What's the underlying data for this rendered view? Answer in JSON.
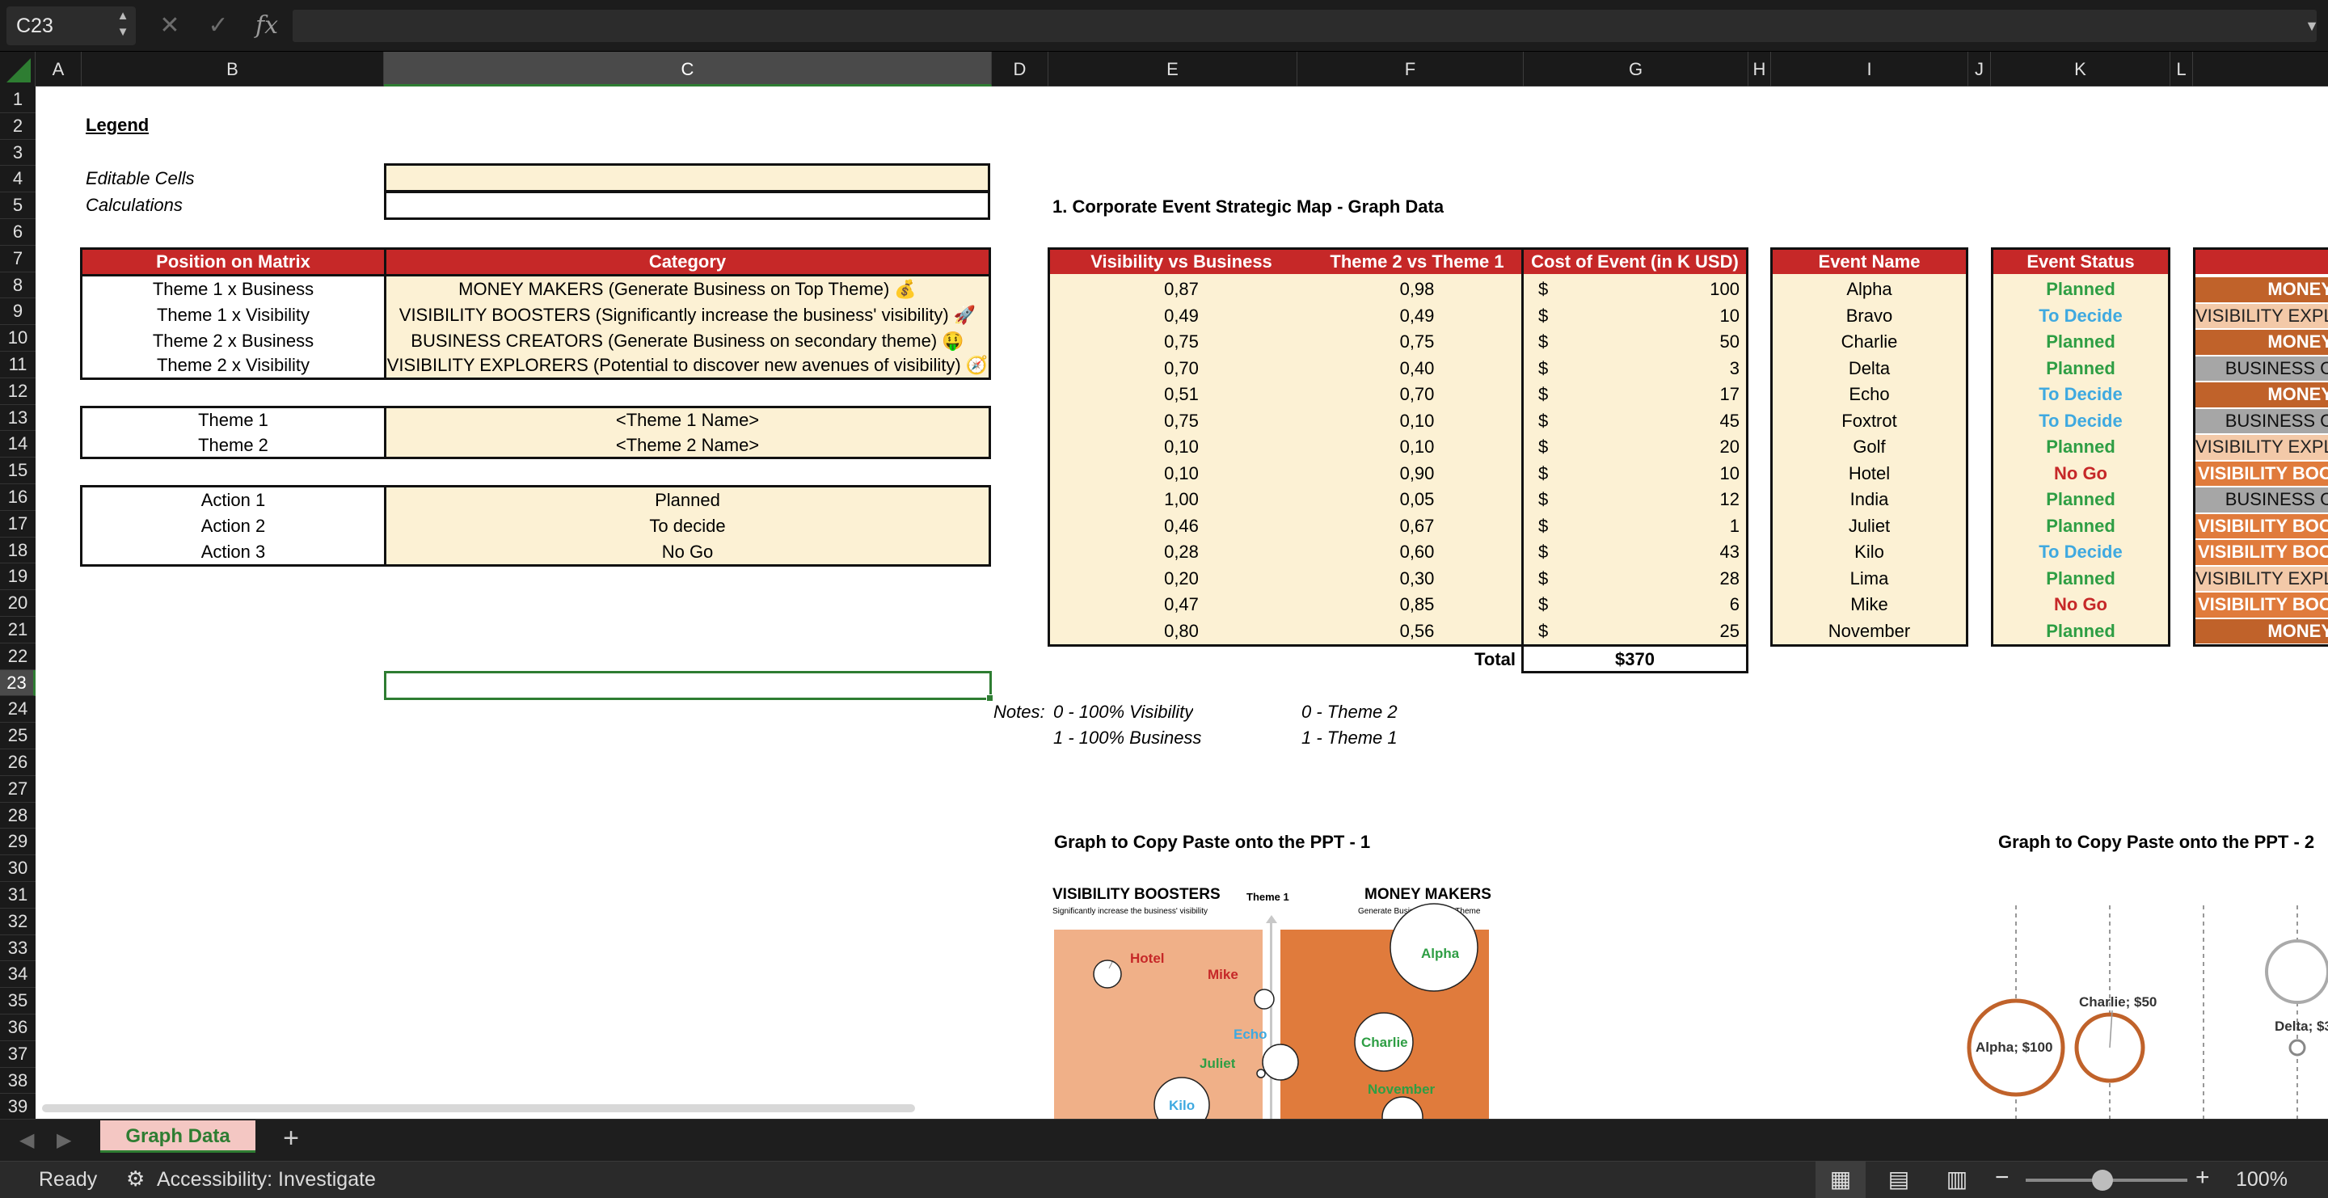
{
  "name_box": "C23",
  "columns": [
    "A",
    "B",
    "C",
    "D",
    "E",
    "F",
    "G",
    "H",
    "I",
    "J",
    "K",
    "L"
  ],
  "rows": [
    "1",
    "2",
    "3",
    "4",
    "5",
    "6",
    "7",
    "8",
    "9",
    "10",
    "11",
    "12",
    "13",
    "14",
    "15",
    "16",
    "17",
    "18",
    "19",
    "20",
    "21",
    "22",
    "23",
    "24",
    "25",
    "26",
    "27",
    "28",
    "29",
    "30",
    "31",
    "32",
    "33",
    "34",
    "35",
    "36",
    "37",
    "38",
    "39"
  ],
  "legend": {
    "title": "Legend",
    "editable": "Editable Cells",
    "calculations": "Calculations"
  },
  "matrix": {
    "header_position": "Position on Matrix",
    "header_category": "Category",
    "rows": [
      {
        "position": "Theme 1 x Business",
        "category": "MONEY MAKERS (Generate Business on Top Theme) 💰"
      },
      {
        "position": "Theme 1 x Visibility",
        "category": "VISIBILITY BOOSTERS (Significantly increase the business' visibility) 🚀"
      },
      {
        "position": "Theme 2 x Business",
        "category": "BUSINESS CREATORS (Generate Business on secondary theme) 🤑"
      },
      {
        "position": "Theme 2 x Visibility",
        "category": "VISIBILITY EXPLORERS (Potential to discover new avenues of visibility) 🧭"
      }
    ]
  },
  "themes": [
    {
      "label": "Theme 1",
      "value": "<Theme 1 Name>"
    },
    {
      "label": "Theme 2",
      "value": "<Theme 2 Name>"
    }
  ],
  "actions": [
    {
      "label": "Action 1",
      "value": "Planned"
    },
    {
      "label": "Action 2",
      "value": "To decide"
    },
    {
      "label": "Action 3",
      "value": "No Go"
    }
  ],
  "section_title": "1. Corporate Event Strategic Map - Graph Data",
  "data_headers": {
    "visibility": "Visibility vs Business",
    "theme": "Theme 2 vs Theme 1",
    "cost": "Cost of Event (in K USD)",
    "name": "Event Name",
    "status": "Event Status"
  },
  "currency": "$",
  "events": [
    {
      "vis": "0,87",
      "theme": "0,98",
      "cost": "100",
      "name": "Alpha",
      "status": "Planned",
      "cat": "MONEY"
    },
    {
      "vis": "0,49",
      "theme": "0,49",
      "cost": "10",
      "name": "Bravo",
      "status": "To Decide",
      "cat": "VISIBILITY EXPL"
    },
    {
      "vis": "0,75",
      "theme": "0,75",
      "cost": "50",
      "name": "Charlie",
      "status": "Planned",
      "cat": "MONEY"
    },
    {
      "vis": "0,70",
      "theme": "0,40",
      "cost": "3",
      "name": "Delta",
      "status": "Planned",
      "cat": "BUSINESS C"
    },
    {
      "vis": "0,51",
      "theme": "0,70",
      "cost": "17",
      "name": "Echo",
      "status": "To Decide",
      "cat": "MONEY"
    },
    {
      "vis": "0,75",
      "theme": "0,10",
      "cost": "45",
      "name": "Foxtrot",
      "status": "To Decide",
      "cat": "BUSINESS C"
    },
    {
      "vis": "0,10",
      "theme": "0,10",
      "cost": "20",
      "name": "Golf",
      "status": "Planned",
      "cat": "VISIBILITY EXPL"
    },
    {
      "vis": "0,10",
      "theme": "0,90",
      "cost": "10",
      "name": "Hotel",
      "status": "No Go",
      "cat": "VISIBILITY BOO"
    },
    {
      "vis": "1,00",
      "theme": "0,05",
      "cost": "12",
      "name": "India",
      "status": "Planned",
      "cat": "BUSINESS C"
    },
    {
      "vis": "0,46",
      "theme": "0,67",
      "cost": "1",
      "name": "Juliet",
      "status": "Planned",
      "cat": "VISIBILITY BOO"
    },
    {
      "vis": "0,28",
      "theme": "0,60",
      "cost": "43",
      "name": "Kilo",
      "status": "To Decide",
      "cat": "VISIBILITY BOO"
    },
    {
      "vis": "0,20",
      "theme": "0,30",
      "cost": "28",
      "name": "Lima",
      "status": "Planned",
      "cat": "VISIBILITY EXPL"
    },
    {
      "vis": "0,47",
      "theme": "0,85",
      "cost": "6",
      "name": "Mike",
      "status": "No Go",
      "cat": "VISIBILITY BOO"
    },
    {
      "vis": "0,80",
      "theme": "0,56",
      "cost": "25",
      "name": "November",
      "status": "Planned",
      "cat": "MONEY"
    }
  ],
  "total_label": "Total",
  "total_value": "$370",
  "notes": {
    "label": "Notes:",
    "l1a": "0 - 100% Visibility",
    "l1b": "0 - Theme 2",
    "l2a": "1 - 100% Business",
    "l2b": "1 - Theme 1"
  },
  "graph1": {
    "title": "Graph to Copy Paste onto the PPT - 1",
    "left_title": "VISIBILITY BOOSTERS",
    "left_sub": "Significantly increase the business' visibility",
    "axis_label": "Theme 1",
    "right_title": "MONEY MAKERS",
    "right_sub": "Generate Business on Top Theme",
    "labels": {
      "hotel": "Hotel",
      "mike": "Mike",
      "echo": "Echo",
      "juliet": "Juliet",
      "kilo": "Kilo",
      "alpha": "Alpha",
      "charlie": "Charlie",
      "november": "November"
    }
  },
  "graph2": {
    "title": "Graph to Copy Paste onto the PPT - 2",
    "alpha": "Alpha; $100",
    "charlie": "Charlie; $50",
    "delta": "Delta; $3"
  },
  "sheet_tab": "Graph Data",
  "add_sheet": "+",
  "status": {
    "ready": "Ready",
    "accessibility": "Accessibility: Investigate",
    "zoom": "100%"
  },
  "colors": {
    "accent_red": "#c62828",
    "cream": "#fcf1d4",
    "planned": "#2e9e44",
    "to_decide": "#3fa9e0",
    "no_go": "#c62828",
    "money": "#c0622a",
    "vis_expl": "#f3c9a8",
    "business": "#a6a6a6",
    "vis_boost": "#e07b3c",
    "selection": "#2e7d32"
  }
}
